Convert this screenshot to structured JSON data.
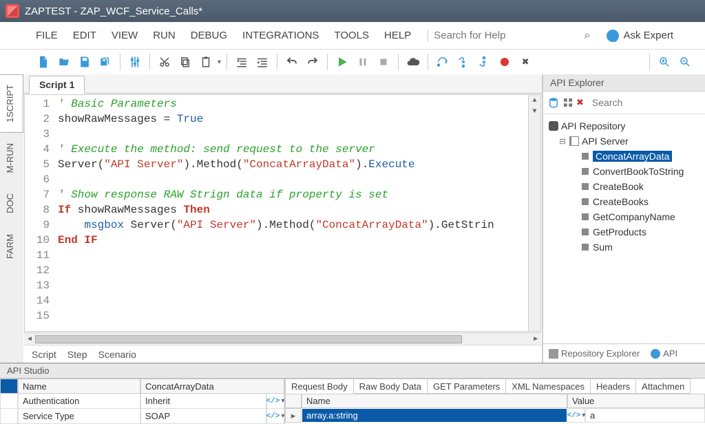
{
  "app": {
    "title": "ZAPTEST - ZAP_WCF_Service_Calls*"
  },
  "menu": {
    "items": [
      "FILE",
      "EDIT",
      "VIEW",
      "RUN",
      "DEBUG",
      "INTEGRATIONS",
      "TOOLS",
      "HELP"
    ],
    "search_placeholder": "Search for Help",
    "ask_expert": "Ask Expert"
  },
  "side_tabs": [
    "1SCRIPT",
    "M-RUN",
    "DOC",
    "FARM"
  ],
  "script_tab": "Script 1",
  "code": {
    "lines": [
      {
        "n": 1,
        "segs": [
          {
            "t": "' Basic Parameters",
            "c": "c-comment"
          }
        ]
      },
      {
        "n": 2,
        "segs": [
          {
            "t": "showRawMessages = "
          },
          {
            "t": "True",
            "c": "c-func"
          }
        ]
      },
      {
        "n": 3,
        "segs": []
      },
      {
        "n": 4,
        "segs": [
          {
            "t": "' Execute the method: send request to the server",
            "c": "c-comment"
          }
        ]
      },
      {
        "n": 5,
        "segs": [
          {
            "t": "Server("
          },
          {
            "t": "\"API Server\"",
            "c": "c-str"
          },
          {
            "t": ").Method("
          },
          {
            "t": "\"ConcatArrayData\"",
            "c": "c-str"
          },
          {
            "t": ")."
          },
          {
            "t": "Execute",
            "c": "c-func"
          }
        ]
      },
      {
        "n": 6,
        "segs": []
      },
      {
        "n": 7,
        "segs": [
          {
            "t": "' Show response RAW Strign data if property is set",
            "c": "c-comment"
          }
        ]
      },
      {
        "n": 8,
        "segs": [
          {
            "t": "If",
            "c": "c-kw"
          },
          {
            "t": " showRawMessages "
          },
          {
            "t": "Then",
            "c": "c-kw"
          }
        ]
      },
      {
        "n": 9,
        "segs": [
          {
            "t": "    "
          },
          {
            "t": "msgbox",
            "c": "c-func"
          },
          {
            "t": " Server("
          },
          {
            "t": "\"API Server\"",
            "c": "c-str"
          },
          {
            "t": ").Method("
          },
          {
            "t": "\"ConcatArrayData\"",
            "c": "c-str"
          },
          {
            "t": ").GetStrin"
          }
        ]
      },
      {
        "n": 10,
        "segs": [
          {
            "t": "End IF",
            "c": "c-kw"
          }
        ]
      },
      {
        "n": 11,
        "segs": []
      },
      {
        "n": 12,
        "segs": []
      },
      {
        "n": 13,
        "segs": []
      },
      {
        "n": 14,
        "segs": []
      },
      {
        "n": 15,
        "segs": []
      }
    ]
  },
  "bottom_tabs": [
    "Script",
    "Step",
    "Scenario"
  ],
  "explorer": {
    "title": "API Explorer",
    "search_placeholder": "Search",
    "root": "API Repository",
    "server_label": "API Server",
    "methods": [
      "ConcatArrayData",
      "ConvertBookToString",
      "CreateBook",
      "CreateBooks",
      "GetCompanyName",
      "GetProducts",
      "Sum"
    ],
    "selected_index": 0,
    "btabs": [
      "Repository Explorer",
      "API "
    ]
  },
  "api_studio": {
    "title": "API Studio",
    "left": {
      "header": [
        "Name",
        "ConcatArrayData"
      ],
      "rows": [
        [
          "Authentication",
          "Inherit"
        ],
        [
          "Service Type",
          "SOAP"
        ]
      ]
    },
    "right": {
      "tabs": [
        "Request Body",
        "Raw Body Data",
        "GET Parameters",
        "XML Namespaces",
        "Headers",
        "Attachmen"
      ],
      "columns": [
        "Name",
        "Value"
      ],
      "row": {
        "name": "array.a:string",
        "value": "a"
      }
    }
  }
}
